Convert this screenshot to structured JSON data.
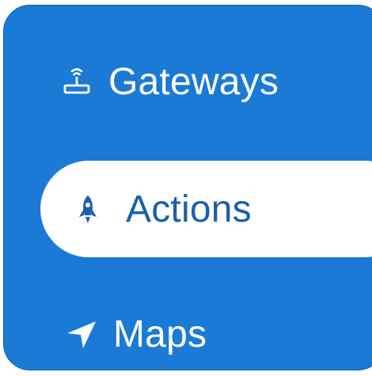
{
  "nav": {
    "items": [
      {
        "label": "Gateways",
        "icon": "router-icon",
        "selected": false
      },
      {
        "label": "Actions",
        "icon": "rocket-icon",
        "selected": true
      },
      {
        "label": "Maps",
        "icon": "location-arrow-icon",
        "selected": false
      }
    ]
  },
  "colors": {
    "panel_bg": "#1a7ad6",
    "selected_bg": "#ffffff",
    "selected_text": "#1b5fae",
    "text": "#ffffff"
  }
}
